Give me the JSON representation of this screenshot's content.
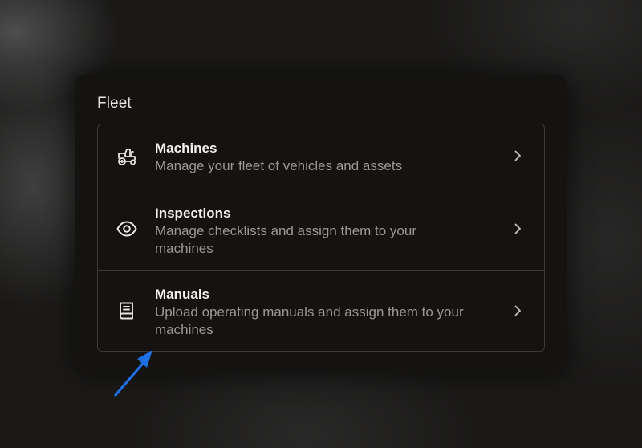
{
  "panel": {
    "title": "Fleet"
  },
  "items": [
    {
      "title": "Machines",
      "description": "Manage your fleet of vehicles and assets",
      "icon": "tractor-icon"
    },
    {
      "title": "Inspections",
      "description": "Manage checklists and assign them to your machines",
      "icon": "eye-icon"
    },
    {
      "title": "Manuals",
      "description": "Upload operating manuals and assign them to your machines",
      "icon": "book-icon"
    }
  ],
  "colors": {
    "panel_background": "#141312",
    "title_text": "#f2f0ed",
    "description_text": "#9a9895",
    "divider": "#3a3937",
    "annotation_arrow": "#1f6fe5"
  }
}
